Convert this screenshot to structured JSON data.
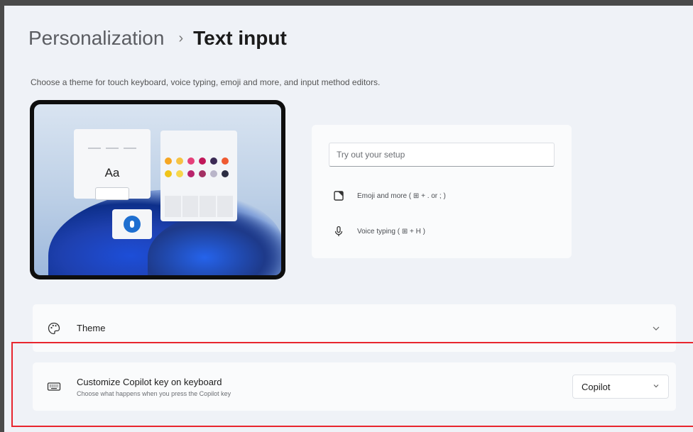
{
  "header": {
    "parent": "Personalization",
    "separator": "›",
    "current": "Text input"
  },
  "description": "Choose a theme for touch keyboard, voice typing, emoji and more, and input method editors.",
  "preview": {
    "keyboard_sample": "Aa",
    "emoji_colors": [
      "#f6a623",
      "#f6c343",
      "#e5407a",
      "#c0185a",
      "#3b2a55",
      "#ef5a32",
      "#f0c419",
      "#f7d74a",
      "#b9246c",
      "#a33063",
      "#b9b5c9",
      "#2b2d42"
    ]
  },
  "tryout": {
    "input_placeholder": "Try out your setup",
    "emoji_link": "Emoji and more ( ⊞ + . or ; )",
    "voice_link": "Voice typing ( ⊞ + H )"
  },
  "settings": {
    "theme": {
      "title": "Theme",
      "icon": "palette-icon"
    },
    "copilot": {
      "title": "Customize Copilot key on keyboard",
      "subtitle": "Choose what happens when you press the Copilot key",
      "icon": "keyboard-icon",
      "dropdown_value": "Copilot"
    }
  },
  "colors": {
    "highlight": "#e8262e",
    "accent": "#1f6fd0"
  }
}
